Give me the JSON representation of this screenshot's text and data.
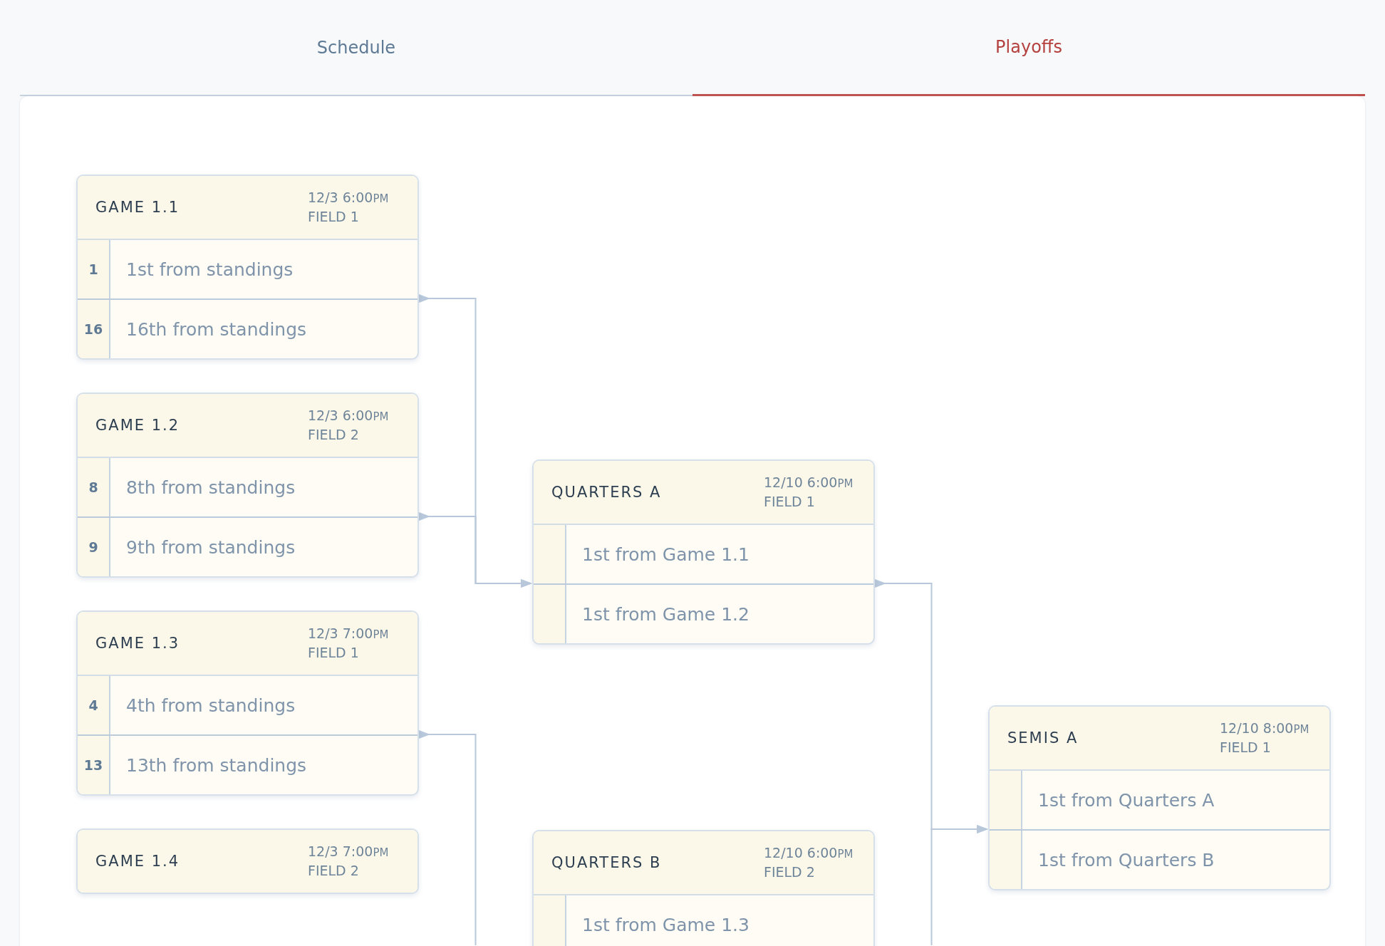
{
  "tabs": [
    {
      "label": "Schedule",
      "selected": false
    },
    {
      "label": "Playoffs",
      "selected": true
    }
  ],
  "rounds": [
    {
      "games": [
        {
          "title": "GAME 1.1",
          "time": "12/3 6:00",
          "meridiem": "PM",
          "field": "FIELD 1",
          "slots": [
            {
              "seed": "1",
              "team": "1st from standings"
            },
            {
              "seed": "16",
              "team": "16th from standings"
            }
          ]
        },
        {
          "title": "GAME 1.2",
          "time": "12/3 6:00",
          "meridiem": "PM",
          "field": "FIELD 2",
          "slots": [
            {
              "seed": "8",
              "team": "8th from standings"
            },
            {
              "seed": "9",
              "team": "9th from standings"
            }
          ]
        },
        {
          "title": "GAME 1.3",
          "time": "12/3 7:00",
          "meridiem": "PM",
          "field": "FIELD 1",
          "slots": [
            {
              "seed": "4",
              "team": "4th from standings"
            },
            {
              "seed": "13",
              "team": "13th from standings"
            }
          ]
        },
        {
          "title": "GAME 1.4",
          "time": "12/3 7:00",
          "meridiem": "PM",
          "field": "FIELD 2"
        }
      ]
    },
    {
      "games": [
        {
          "title": "QUARTERS A",
          "time": "12/10 6:00",
          "meridiem": "PM",
          "field": "FIELD 1",
          "slots": [
            {
              "team": "1st from Game 1.1"
            },
            {
              "team": "1st from Game 1.2"
            }
          ]
        },
        {
          "title": "QUARTERS B",
          "time": "12/10 6:00",
          "meridiem": "PM",
          "field": "FIELD 2",
          "slots": [
            {
              "team": "1st from Game 1.3"
            }
          ]
        }
      ]
    },
    {
      "games": [
        {
          "title": "SEMIS A",
          "time": "12/10 8:00",
          "meridiem": "PM",
          "field": "FIELD 1",
          "slots": [
            {
              "team": "1st from Quarters A"
            },
            {
              "team": "1st from Quarters B"
            }
          ]
        }
      ]
    }
  ]
}
